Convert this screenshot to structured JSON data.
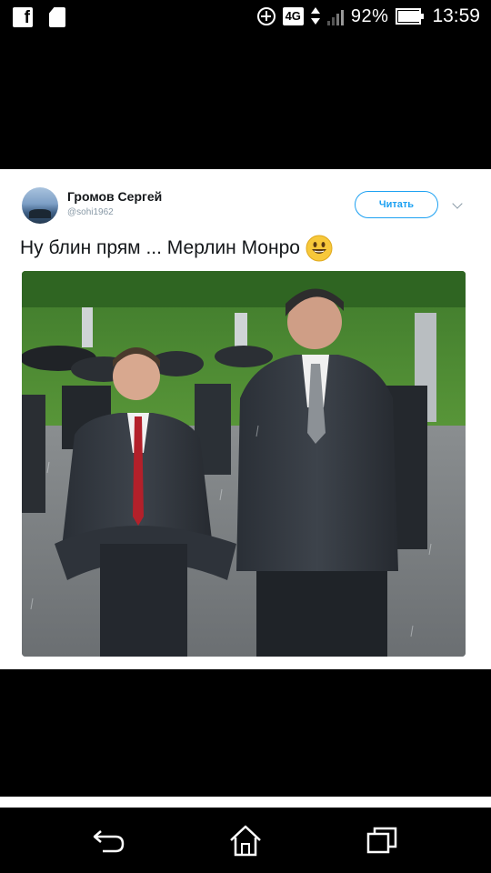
{
  "status_bar": {
    "left_icons": [
      "facebook-icon",
      "sd-card-icon"
    ],
    "network_type": "4G",
    "battery_percent": "92%",
    "battery_level": 0.92,
    "time": "13:59"
  },
  "tweet": {
    "author_name": "Громов Сергей",
    "author_handle": "@sohi1962",
    "follow_label": "Читать",
    "text": "Ну блин прям ... Мерлин Монро",
    "emoji": "smiling-face-emoji",
    "accent_color": "#1da1f2"
  },
  "nav_bar": {
    "buttons": [
      "back-icon",
      "home-icon",
      "recent-apps-icon"
    ]
  }
}
